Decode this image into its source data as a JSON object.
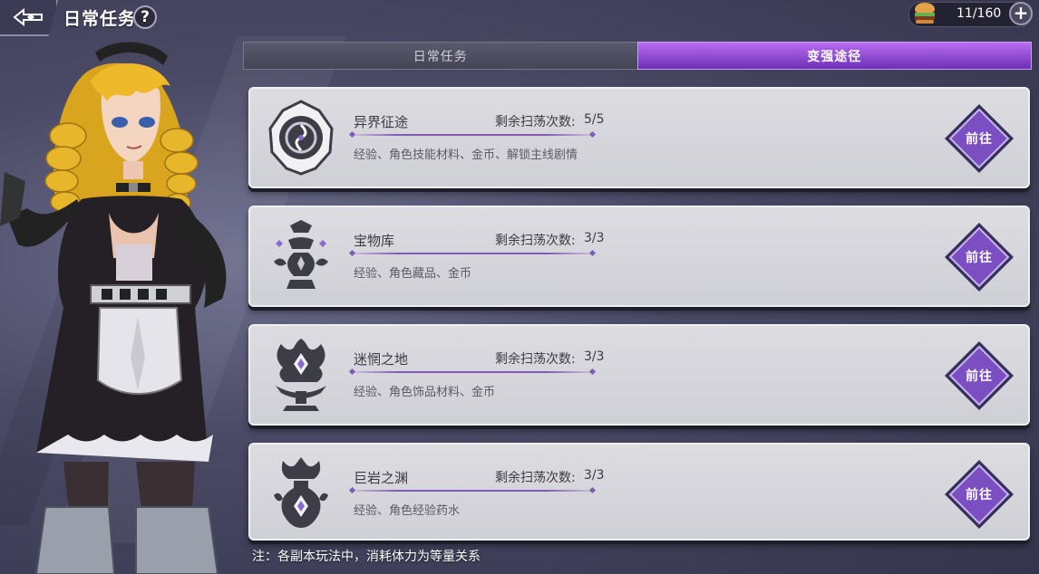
{
  "header": {
    "title": "日常任务",
    "help_label": "?"
  },
  "stamina": {
    "value": "11/160",
    "plus_label": "+",
    "icon": "burger-icon"
  },
  "tabs": [
    {
      "label": "日常任务",
      "active": false
    },
    {
      "label": "变强途径",
      "active": true
    }
  ],
  "tasks": [
    {
      "name": "异界征途",
      "count_label": "剩余扫荡次数:",
      "count": "5/5",
      "rewards": "经验、角色技能材料、金币、解锁主线剧情",
      "go_label": "前往",
      "icon": "portal-emblem-icon"
    },
    {
      "name": "宝物库",
      "count_label": "剩余扫荡次数:",
      "count": "3/3",
      "rewards": "经验、角色藏品、金币",
      "go_label": "前往",
      "icon": "treasure-vase-emblem-icon"
    },
    {
      "name": "迷惘之地",
      "count_label": "剩余扫荡次数:",
      "count": "3/3",
      "rewards": "经验、角色饰品材料、金币",
      "go_label": "前往",
      "icon": "crystal-tree-emblem-icon"
    },
    {
      "name": "巨岩之渊",
      "count_label": "剩余扫荡次数:",
      "count": "3/3",
      "rewards": "经验、角色经验药水",
      "go_label": "前往",
      "icon": "flask-emblem-icon"
    }
  ],
  "footnote": "注：各副本玩法中，消耗体力为等量关系",
  "colors": {
    "accent_purple": "#7b4fc2",
    "tab_active": "#a35be6",
    "card_bg": "#d6d6dc"
  }
}
